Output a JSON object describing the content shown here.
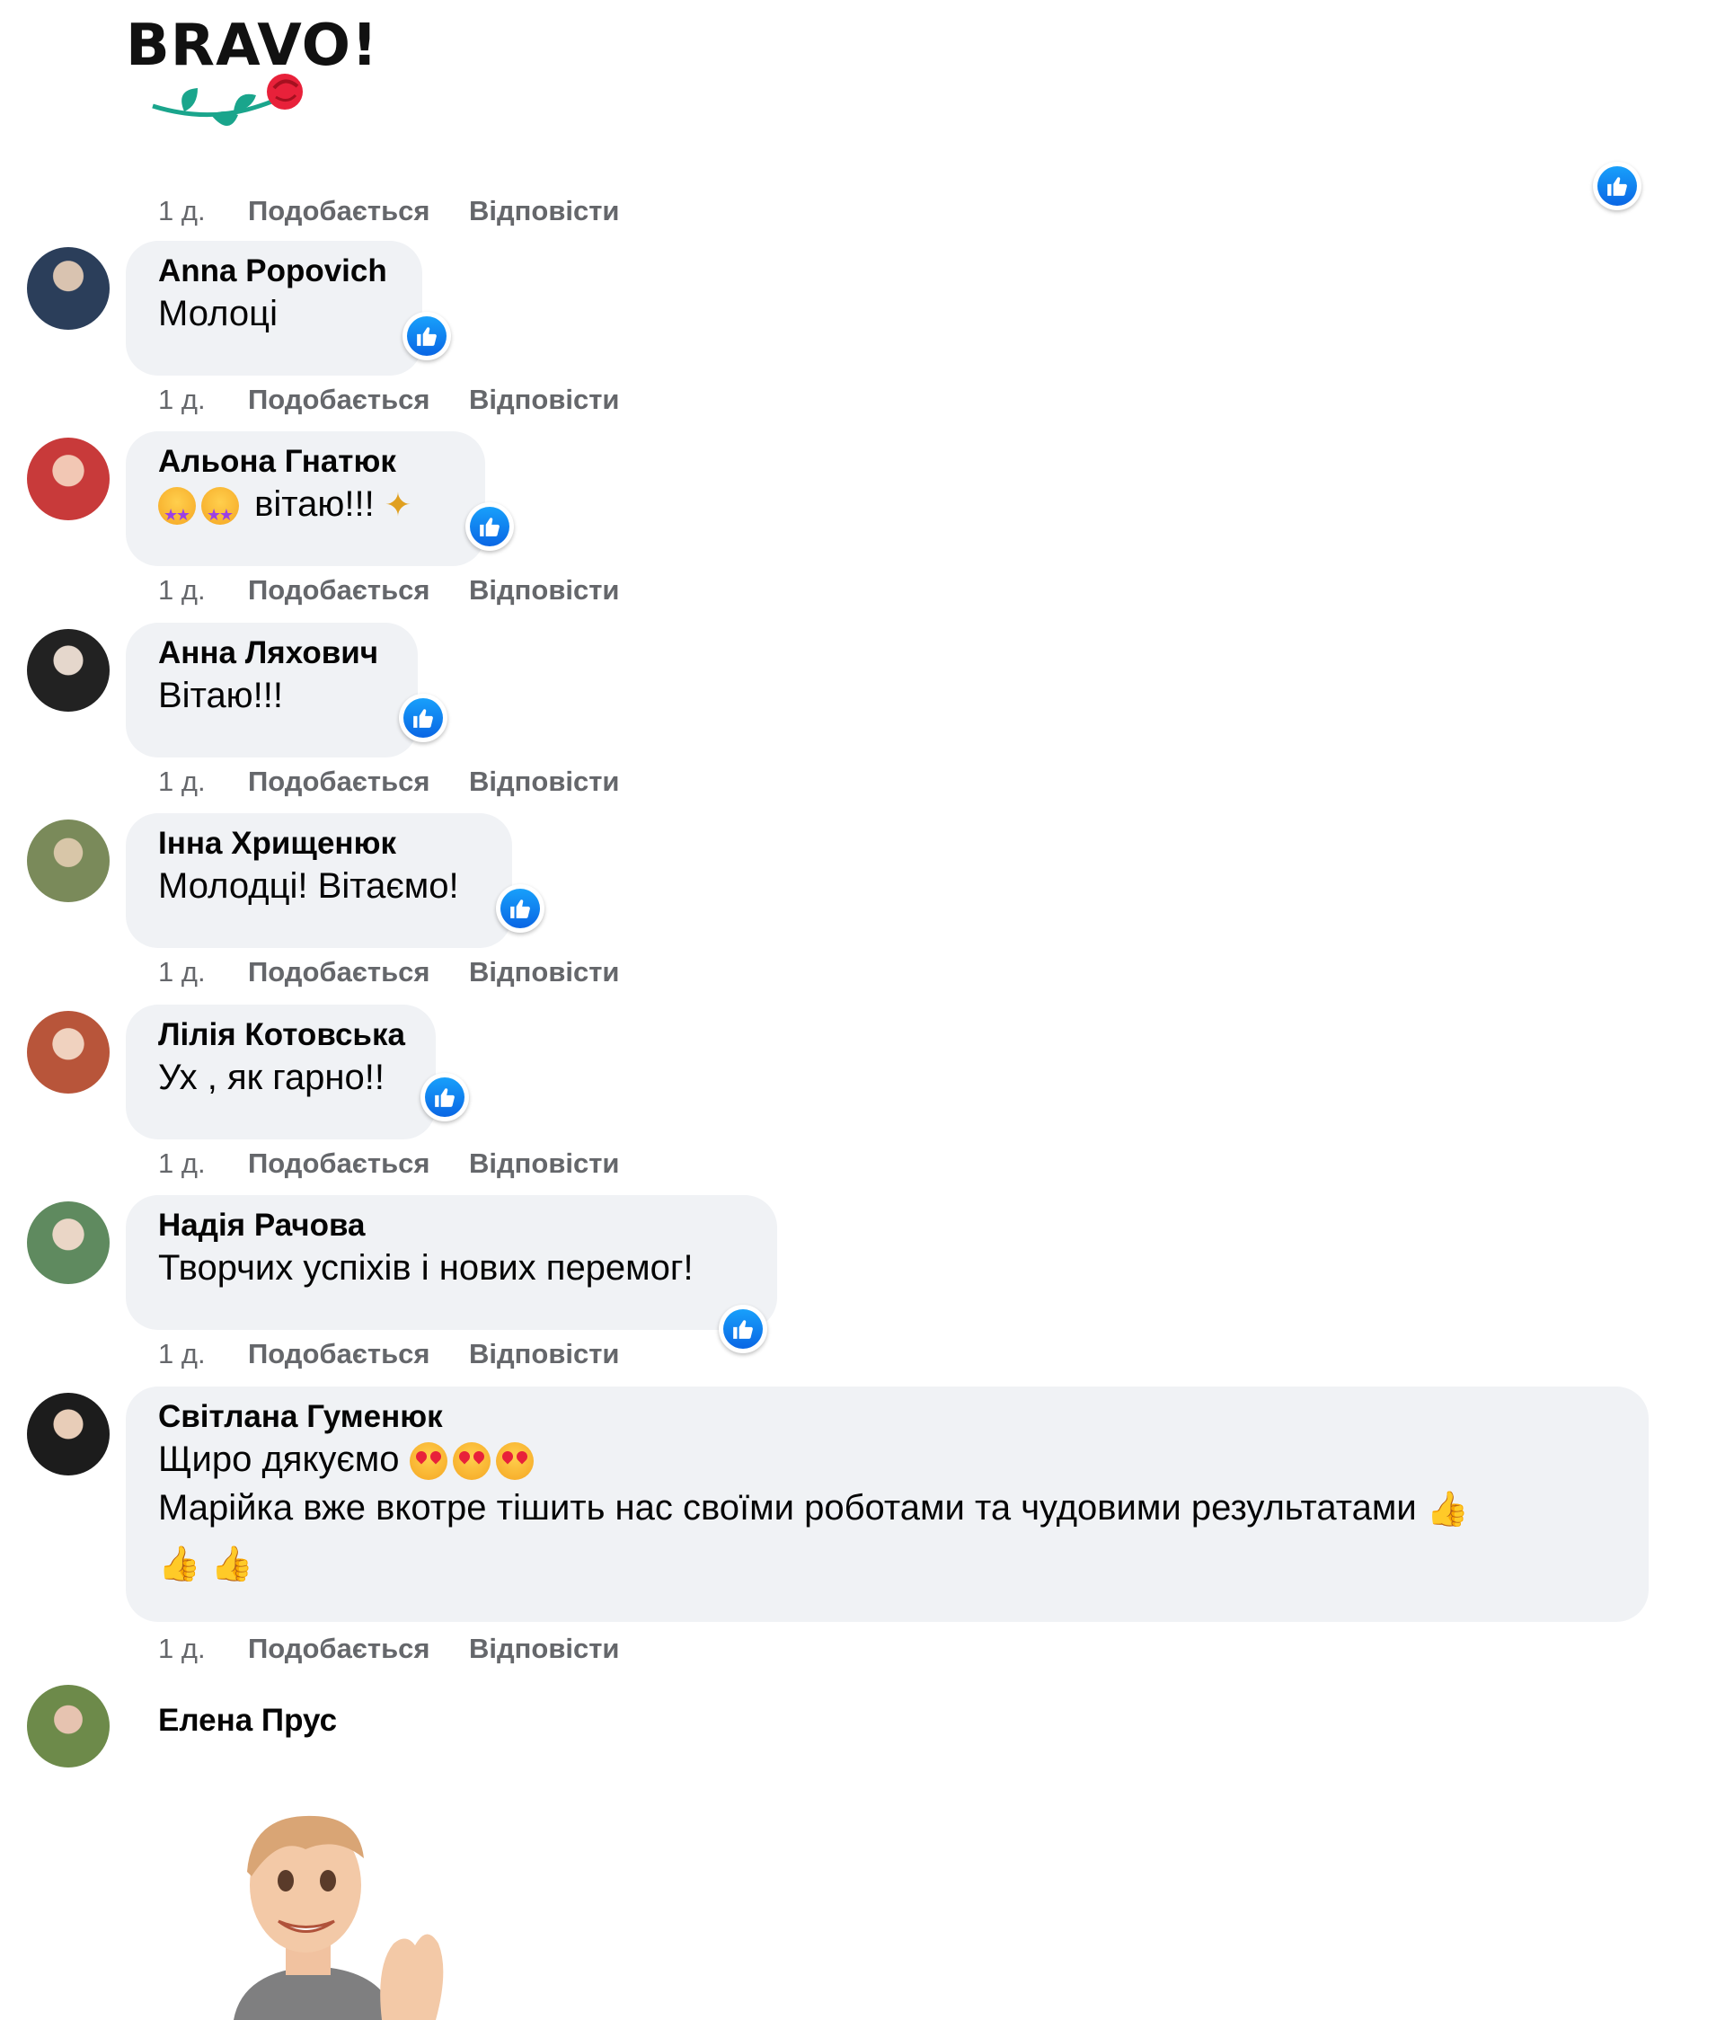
{
  "sticker_top": {
    "text": "BRAVO!"
  },
  "comments": [
    {
      "author": "",
      "text": "",
      "time": "1 д.",
      "like": "Подобається",
      "reply": "Відповісти"
    },
    {
      "author": "Anna Popovich",
      "text": "Молоці",
      "time": "1 д.",
      "like": "Подобається",
      "reply": "Відповісти"
    },
    {
      "author": "Альона Гнатюк",
      "text": "вітаю!!!",
      "time": "1 д.",
      "like": "Подобається",
      "reply": "Відповісти"
    },
    {
      "author": "Анна Ляхович",
      "text": "Вітаю!!!",
      "time": "1 д.",
      "like": "Подобається",
      "reply": "Відповісти"
    },
    {
      "author": "Інна Хрищенюк",
      "text": "Молодці! Вітаємо!",
      "time": "1 д.",
      "like": "Подобається",
      "reply": "Відповісти"
    },
    {
      "author": "Лілія Котовська",
      "text": "Ух , як гарно!!",
      "time": "1 д.",
      "like": "Подобається",
      "reply": "Відповісти"
    },
    {
      "author": "Надія Рачова",
      "text": "Творчих успіхів і нових перемог!",
      "time": "1 д.",
      "like": "Подобається",
      "reply": "Відповісти"
    },
    {
      "author": "Світлана Гуменюк",
      "line1": "Щиро дякуємо",
      "line2": "Марійка вже вкотре тішить нас своїми роботами та чудовими результатами",
      "time": "1 д.",
      "like": "Подобається",
      "reply": "Відповісти"
    },
    {
      "author": "Елена Прус"
    }
  ],
  "colors": {
    "like_blue": "#1877f2",
    "bubble_bg": "#f0f2f5",
    "meta_gray": "#65676b"
  }
}
